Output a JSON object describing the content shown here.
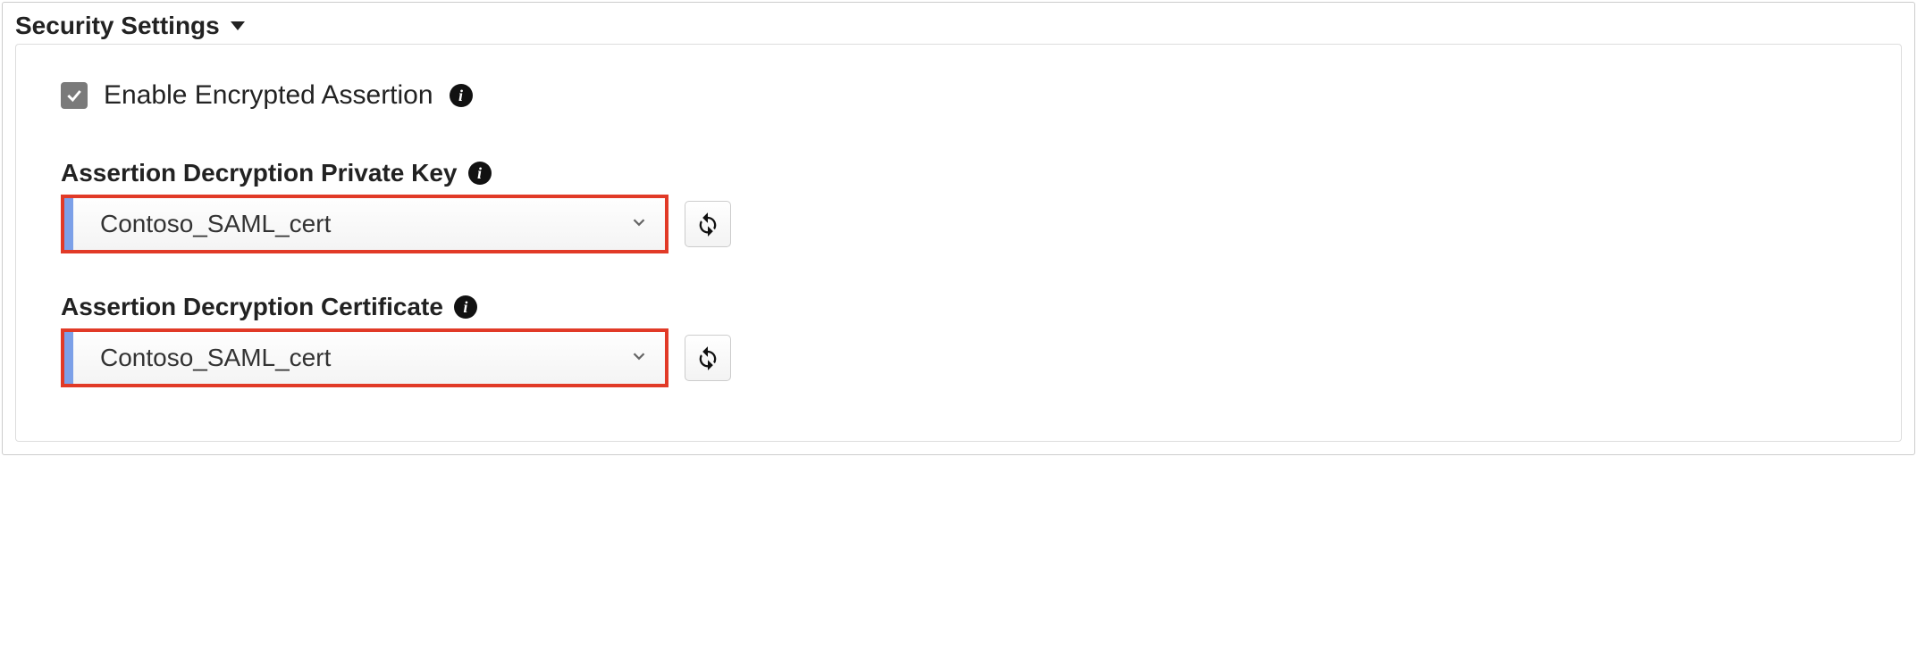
{
  "section": {
    "title": "Security Settings"
  },
  "encrypt": {
    "label": "Enable Encrypted Assertion",
    "checked": true
  },
  "privateKey": {
    "label": "Assertion Decryption Private Key",
    "value": "Contoso_SAML_cert"
  },
  "certificate": {
    "label": "Assertion Decryption Certificate",
    "value": "Contoso_SAML_cert"
  }
}
